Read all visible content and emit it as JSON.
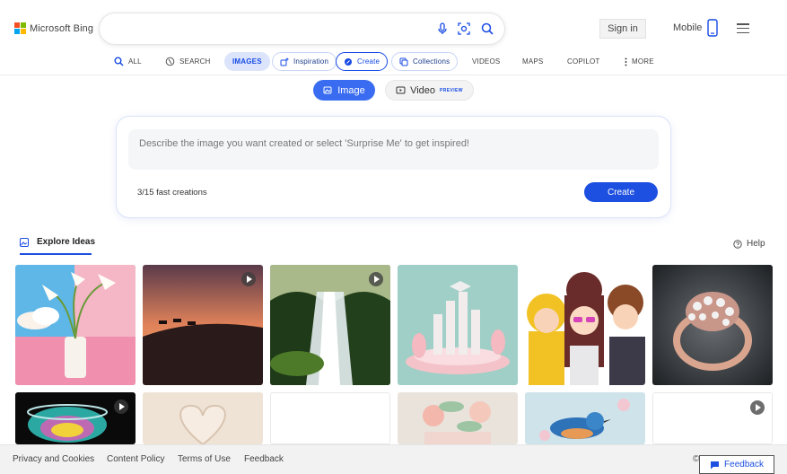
{
  "header": {
    "logo_text": "Microsoft Bing",
    "search_value": "",
    "sign_in": "Sign in",
    "mobile": "Mobile"
  },
  "nav": {
    "items": [
      {
        "label": "ALL",
        "icon": "search-icon"
      },
      {
        "label": "SEARCH",
        "icon": "copilot-search-icon"
      },
      {
        "label": "IMAGES"
      },
      {
        "label": "Inspiration",
        "icon": "sparkle-image-icon"
      },
      {
        "label": "Create",
        "icon": "create-icon"
      },
      {
        "label": "Collections",
        "icon": "collections-icon"
      },
      {
        "label": "VIDEOS"
      },
      {
        "label": "MAPS"
      },
      {
        "label": "COPILOT"
      },
      {
        "label": "MORE",
        "icon": "kebab-icon"
      }
    ]
  },
  "mode": {
    "image": "Image",
    "video": "Video",
    "preview_badge": "PREVIEW"
  },
  "creator": {
    "placeholder": "Describe the image you want created or select 'Surprise Me' to get inspired!",
    "fast_creations": "3/15 fast creations",
    "create_label": "Create"
  },
  "explore": {
    "tab_label": "Explore Ideas",
    "help_label": "Help"
  },
  "footer": {
    "links": [
      "Privacy and Cookies",
      "Content Policy",
      "Terms of Use",
      "Feedback"
    ],
    "copyright": "©",
    "feedback_button": "Feedback"
  },
  "colors": {
    "accent": "#1d4fe0",
    "logo_red": "#f25022",
    "logo_green": "#7fba00",
    "logo_blue": "#00a4ef",
    "logo_yellow": "#ffb900"
  }
}
